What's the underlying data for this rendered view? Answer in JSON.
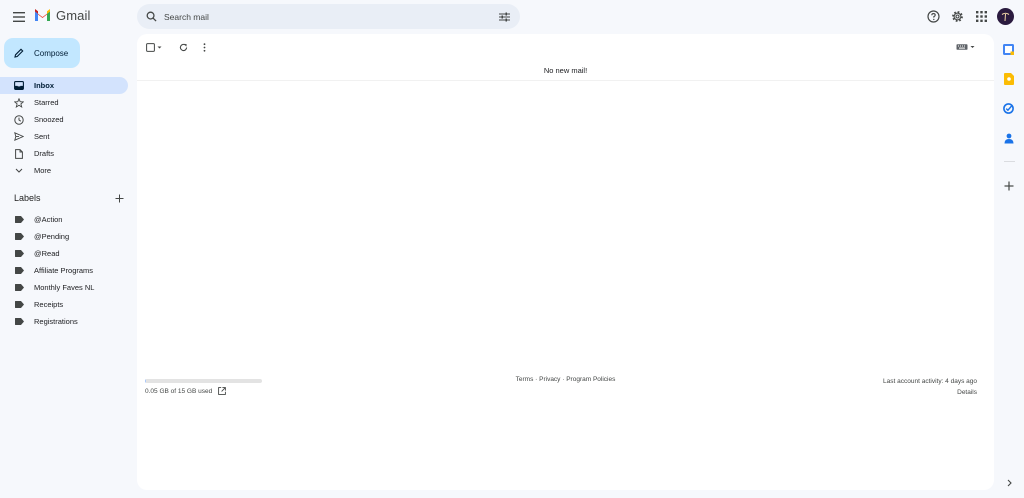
{
  "app": {
    "name": "Gmail"
  },
  "search": {
    "placeholder": "Search mail"
  },
  "compose": {
    "label": "Compose"
  },
  "nav": [
    {
      "label": "Inbox",
      "icon": "inbox-icon",
      "active": true
    },
    {
      "label": "Starred",
      "icon": "star-icon"
    },
    {
      "label": "Snoozed",
      "icon": "clock-icon"
    },
    {
      "label": "Sent",
      "icon": "send-icon"
    },
    {
      "label": "Drafts",
      "icon": "draft-icon"
    },
    {
      "label": "More",
      "icon": "chevron-down-icon"
    }
  ],
  "labels": {
    "title": "Labels",
    "items": [
      "@Action",
      "@Pending",
      "@Read",
      "Affiliate Programs",
      "Monthly Faves NL",
      "Receipts",
      "Registrations"
    ]
  },
  "main": {
    "empty_message": "No new mail!"
  },
  "footer": {
    "storage_text": "0.05 GB of 15 GB used",
    "storage_fraction": 0.003,
    "links": "Terms · Privacy · Program Policies",
    "last_activity": "Last account activity: 4 days ago",
    "details": "Details"
  },
  "colors": {
    "accent": "#c2e7ff",
    "active_nav": "#d3e3fd",
    "background": "#f6f8fc"
  }
}
